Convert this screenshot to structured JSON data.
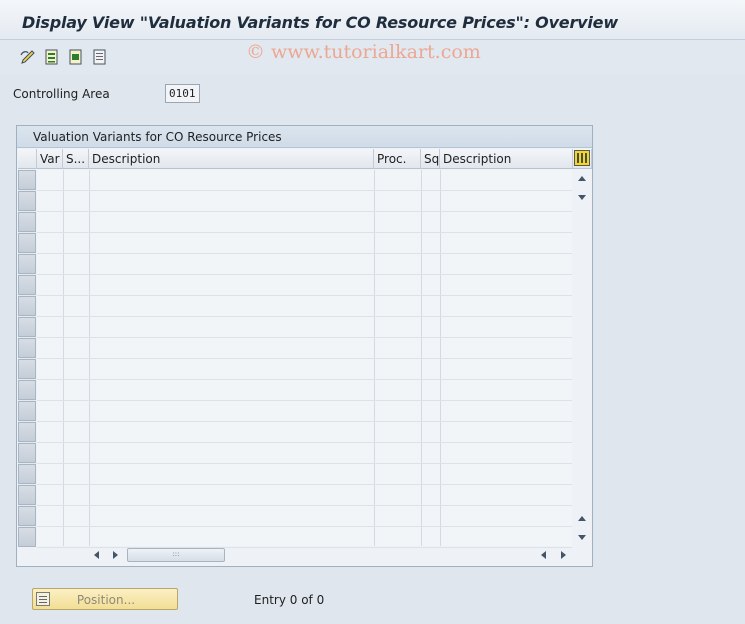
{
  "window": {
    "title": "Display View \"Valuation Variants for CO Resource Prices\": Overview"
  },
  "toolbar": {
    "icons": [
      "display-change-icon",
      "select-all-icon",
      "select-block-icon",
      "deselect-all-icon"
    ]
  },
  "watermark": "© www.tutorialkart.com",
  "controlling_area": {
    "label": "Controlling Area",
    "value": "0101"
  },
  "table": {
    "title": "Valuation Variants for CO Resource Prices",
    "columns": [
      "Var",
      "S...",
      "Description",
      "Proc.",
      "Sq",
      "Description"
    ],
    "visible_rows": 18,
    "rows": []
  },
  "footer": {
    "position_button": "Position...",
    "entry_text": "Entry 0 of 0"
  },
  "colors": {
    "background": "#dfe6ee",
    "table_bg": "#f2f5f8",
    "position_button": "#f2de95",
    "watermark": "#ef9c84"
  }
}
